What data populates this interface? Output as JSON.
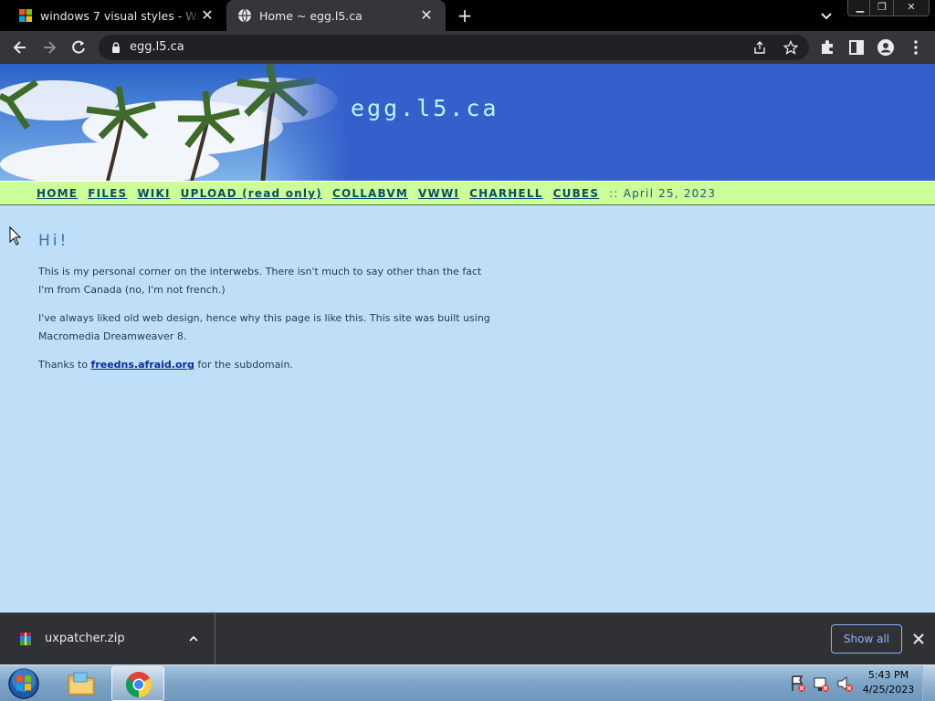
{
  "browser": {
    "tabs": [
      {
        "title": "windows 7 visual styles - Window",
        "icon": "windows-logo-icon"
      },
      {
        "title": "Home ~ egg.l5.ca",
        "icon": "globe-icon"
      }
    ],
    "url": "egg.l5.ca"
  },
  "site": {
    "title": "egg.l5.ca",
    "nav": [
      {
        "label": "HOME"
      },
      {
        "label": "FILES"
      },
      {
        "label": "WIKI"
      },
      {
        "label": "UPLOAD (read only)"
      },
      {
        "label": "COLLABVM"
      },
      {
        "label": "VWWI"
      },
      {
        "label": "CHARHELL"
      },
      {
        "label": "CUBES"
      }
    ],
    "date": ":: April 25, 2023",
    "heading": "Hi!",
    "para1": "This is my personal corner on the interwebs. There isn't much to say other than the fact I'm from Canada (no, I'm not french.)",
    "para2": "I've always liked old web design, hence why this page is like this. This site was built using Macromedia Dreamweaver 8.",
    "para3_before": "Thanks to",
    "para3_link": "freedns.afraid.org",
    "para3_after": "for the subdomain."
  },
  "downloads": {
    "file": "uxpatcher.zip",
    "show_all": "Show all"
  },
  "taskbar": {
    "time": "5:43 PM",
    "date": "4/25/2023"
  },
  "colors": {
    "page_bg": "#bfdff8",
    "banner_bg": "#3560cc",
    "nav_bg": "#ccff99",
    "link": "#0a2aa0"
  }
}
